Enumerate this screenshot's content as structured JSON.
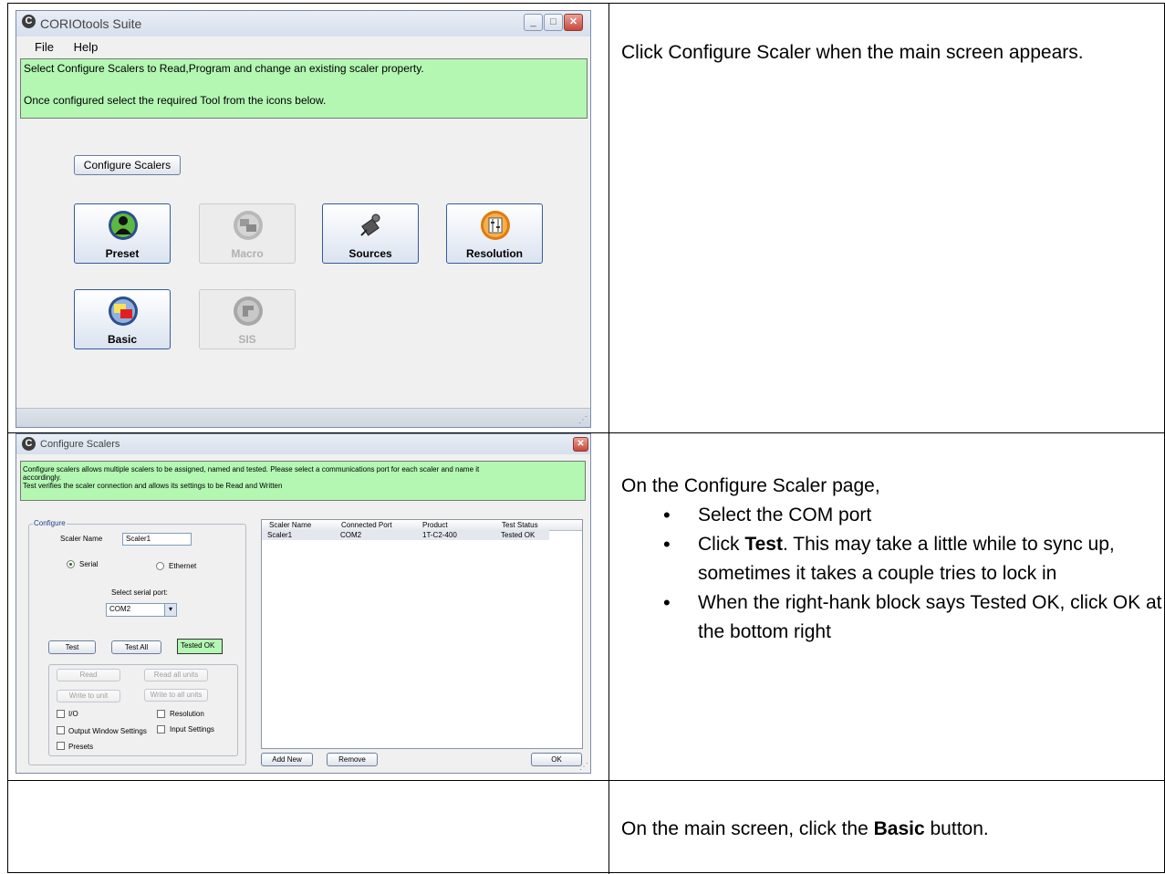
{
  "main_window": {
    "title": "CORIOtools Suite",
    "app_icon_letter": "C",
    "menu": [
      "File",
      "Help"
    ],
    "info_line1": "Select Configure Scalers to Read,Program and change an existing scaler property.",
    "info_line2": "Once configured select the required Tool from the icons below.",
    "configure_button": "Configure Scalers",
    "tools": [
      {
        "label": "Preset",
        "enabled": true,
        "icon": "person-icon"
      },
      {
        "label": "Macro",
        "enabled": false,
        "icon": "macro-icon"
      },
      {
        "label": "Sources",
        "enabled": true,
        "icon": "camera-icon"
      },
      {
        "label": "Resolution",
        "enabled": true,
        "icon": "sliders-icon"
      },
      {
        "label": "Basic",
        "enabled": true,
        "icon": "windows-icon"
      },
      {
        "label": "SIS",
        "enabled": false,
        "icon": "sis-icon"
      }
    ]
  },
  "configure_dialog": {
    "title": "Configure Scalers",
    "info_line1": "Configure scalers allows multiple scalers to be assigned, named and tested. Please select a communications port for each scaler and name it",
    "info_line2": "accordingly.",
    "info_line3": "Test verifies the scaler connection and allows its settings to be Read and Written",
    "group_label": "Configure",
    "scaler_name_label": "Scaler Name",
    "scaler_name_value": "Scaler1",
    "radio_serial": "Serial",
    "radio_ethernet": "Ethernet",
    "serial_port_label": "Select serial port:",
    "serial_port_value": "COM2",
    "test_button": "Test",
    "test_all_button": "Test All",
    "test_status": "Tested OK",
    "read_button": "Read",
    "read_all_button": "Read all units",
    "write_button": "Write to unit",
    "write_all_button": "Write to all units",
    "checkboxes": [
      "I/O",
      "Resolution",
      "Output Window Settings",
      "Input Settings",
      "Presets"
    ],
    "table_headers": [
      "Scaler Name",
      "Connected Port",
      "Product",
      "Test Status"
    ],
    "table_rows": [
      [
        "Scaler1",
        "COM2",
        "1T-C2-400",
        "Tested OK"
      ]
    ],
    "add_new_button": "Add New",
    "remove_button": "Remove",
    "ok_button": "OK"
  },
  "instructions": {
    "step1": "Click Configure Scaler when the main screen appears.",
    "step2_intro": "On the Configure Scaler page,",
    "step2_bullet1": "Select the COM port",
    "step2_bullet2_bold": "Test",
    "step2_bullet2_pre": "Click ",
    "step2_bullet2_post": ". This may take a little while to sync  up, sometimes it takes a couple tries to lock in",
    "step2_bullet3": "When the right-hank block says Tested OK, click OK at the bottom right",
    "step3_pre": "On the main screen, click the ",
    "step3_bold": "Basic",
    "step3_post": " button."
  }
}
